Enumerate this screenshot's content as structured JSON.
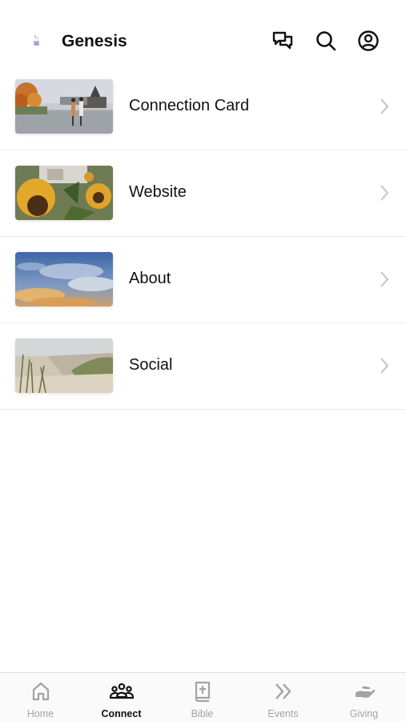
{
  "header": {
    "title": "Genesis",
    "icons": [
      "logo-icon",
      "messages-icon",
      "search-icon",
      "profile-icon"
    ]
  },
  "list": {
    "items": [
      {
        "label": "Connection Card",
        "thumbnail": "autumn-walk-photo"
      },
      {
        "label": "Website",
        "thumbnail": "sunflowers-photo"
      },
      {
        "label": "About",
        "thumbnail": "sunset-clouds-photo"
      },
      {
        "label": "Social",
        "thumbnail": "dune-grass-photo"
      }
    ]
  },
  "tabbar": {
    "tabs": [
      {
        "label": "Home",
        "icon": "home-icon",
        "active": false
      },
      {
        "label": "Connect",
        "icon": "people-icon",
        "active": true
      },
      {
        "label": "Bible",
        "icon": "bible-icon",
        "active": false
      },
      {
        "label": "Events",
        "icon": "double-chevron-icon",
        "active": false
      },
      {
        "label": "Giving",
        "icon": "hand-icon",
        "active": false
      }
    ]
  },
  "colors": {
    "text": "#111111",
    "inactive": "#a3a3a3",
    "divider": "#ececec",
    "chevron": "#c4c4c4"
  }
}
